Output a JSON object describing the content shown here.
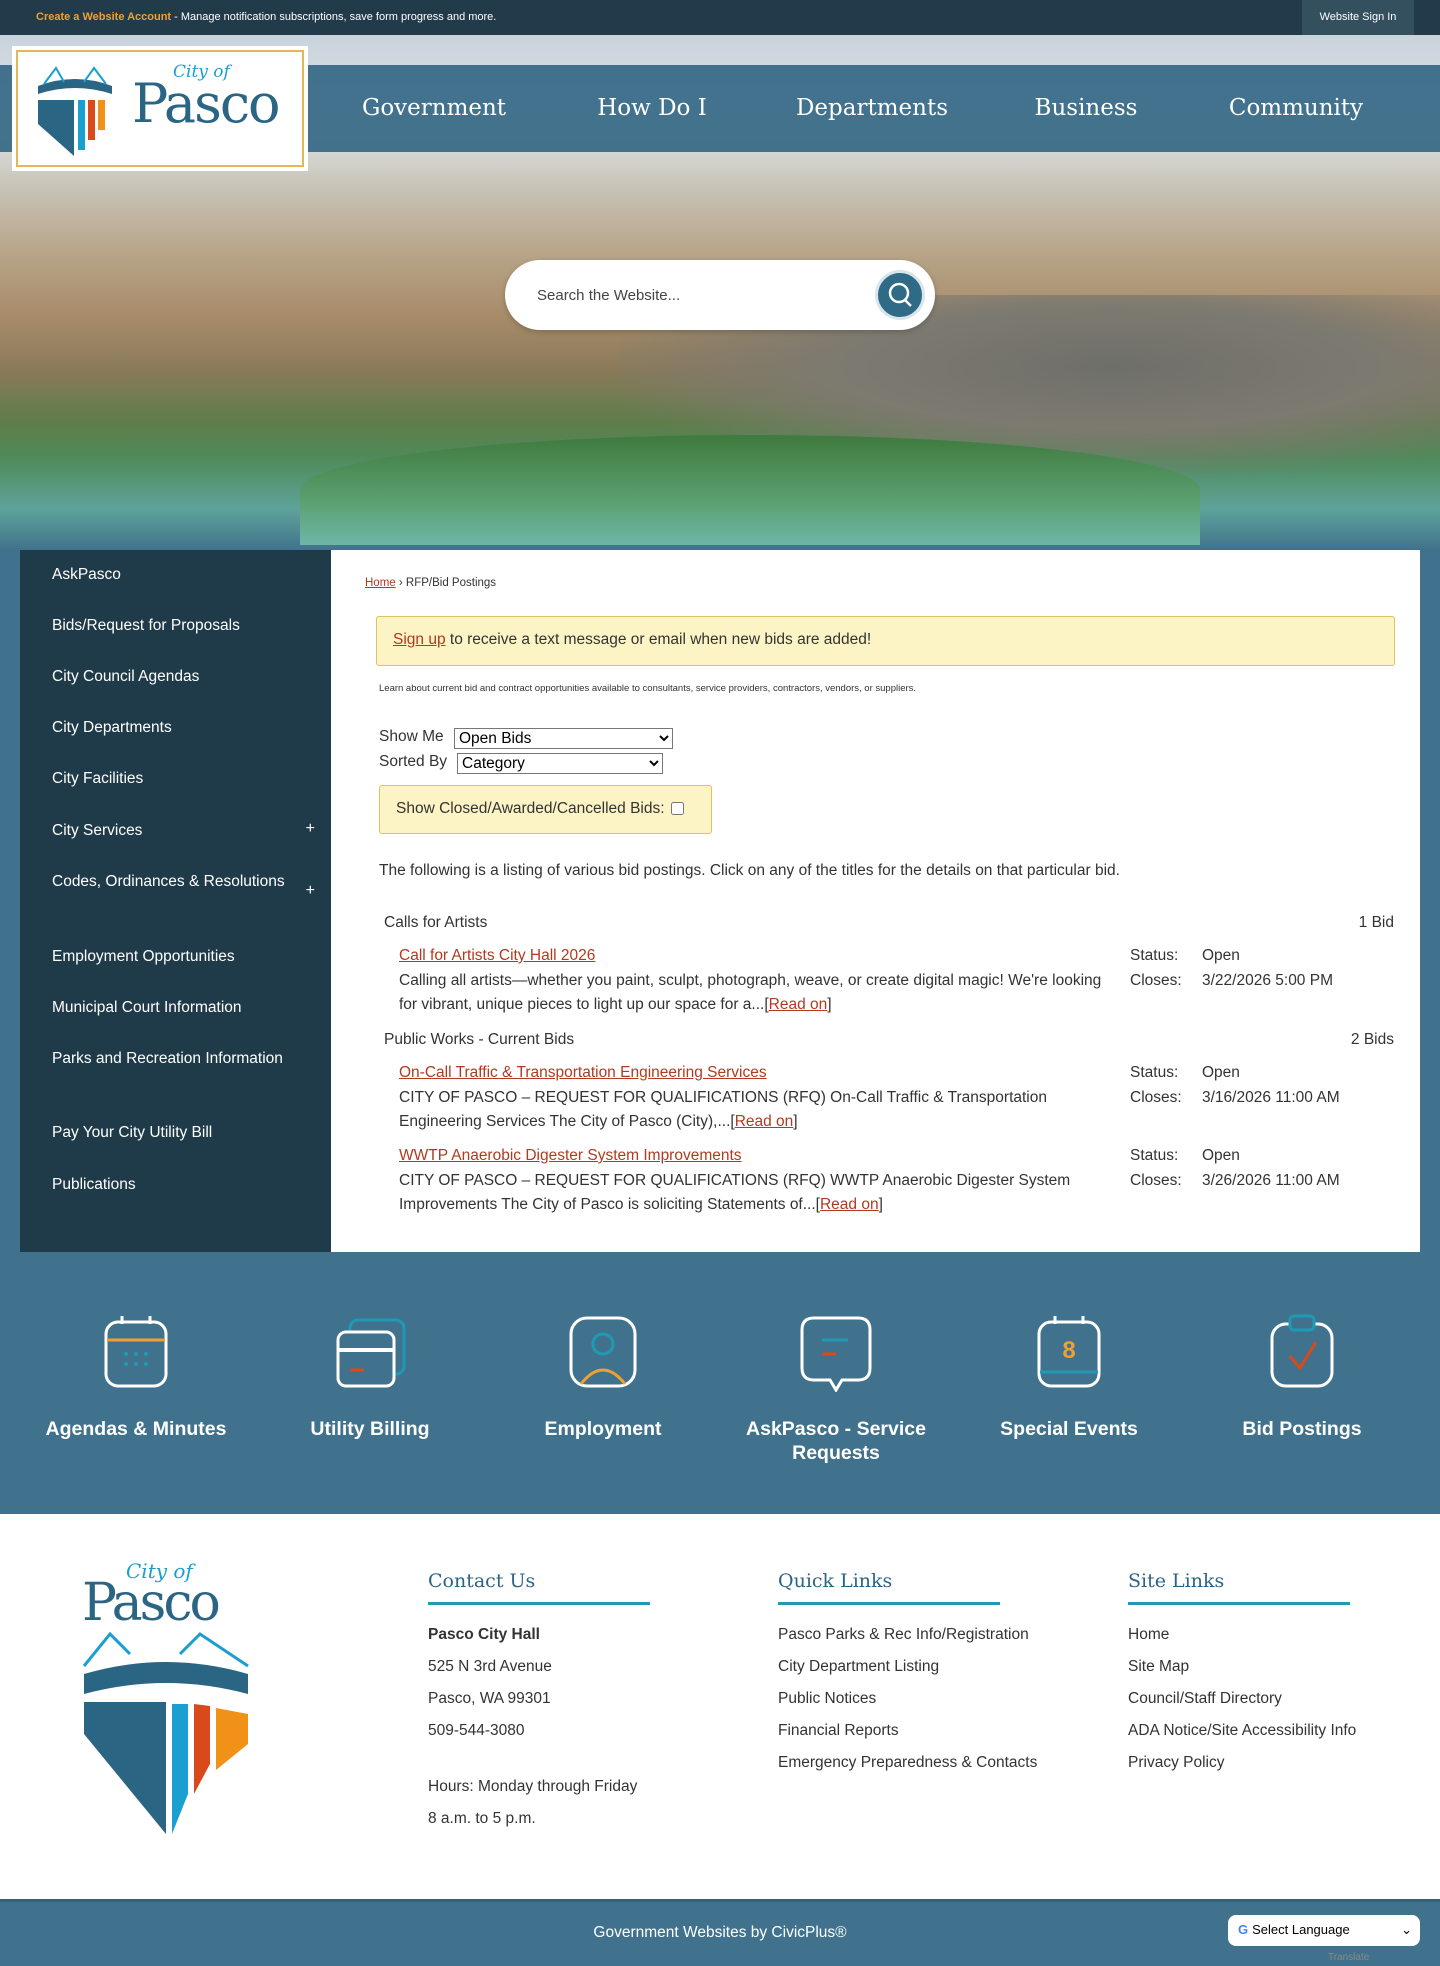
{
  "topbar": {
    "create_account": "Create a Website Account",
    "message": " - Manage notification subscriptions, save form progress and more.",
    "sign_in": "Website Sign In"
  },
  "logo": {
    "city_of": "City of",
    "name": "Pasco"
  },
  "nav": [
    "Government",
    "How Do I",
    "Departments",
    "Business",
    "Community"
  ],
  "search": {
    "placeholder": "Search the Website..."
  },
  "sidebar": [
    {
      "label": "AskPasco"
    },
    {
      "label": "Bids/Request for Proposals"
    },
    {
      "label": "City Council Agendas"
    },
    {
      "label": "City Departments"
    },
    {
      "label": "City Facilities"
    },
    {
      "label": "City Services",
      "expand": "+"
    },
    {
      "label": "Codes, Ordinances & Resolutions",
      "expand": "+"
    },
    {
      "label": "Employment Opportunities"
    },
    {
      "label": "Municipal Court Information"
    },
    {
      "label": "Parks and Recreation Information"
    },
    {
      "label": "Pay Your City Utility Bill"
    },
    {
      "label": "Publications"
    }
  ],
  "breadcrumb": {
    "home": "Home",
    "sep": " › ",
    "current": "RFP/Bid Postings"
  },
  "signup": {
    "link": "Sign up",
    "text": " to receive a text message or email when new bids are added!"
  },
  "learn": "Learn about current bid and contract opportunities available to consultants, service providers, contractors, vendors, or suppliers.",
  "filters": {
    "show_me_label": "Show Me",
    "show_me_value": "Open Bids",
    "sorted_by_label": "Sorted By",
    "sorted_by_value": "Category",
    "closed_label": "Show Closed/Awarded/Cancelled Bids:"
  },
  "intro": "The following is a listing of various bid postings. Click on any of the titles for the details on that particular bid.",
  "categories": [
    {
      "name": "Calls for Artists",
      "count": "1 Bid",
      "bids": [
        {
          "title": "Call for Artists City Hall 2026",
          "desc": "Calling all artists—whether you paint, sculpt, photograph, weave, or create digital magic! We're looking for vibrant, unique pieces to light up our space for a...",
          "status_label": "Status:",
          "status": "Open",
          "closes_label": "Closes:",
          "closes": "3/22/2026 5:00 PM"
        }
      ]
    },
    {
      "name": "Public Works - Current Bids",
      "count": "2 Bids",
      "bids": [
        {
          "title": "On-Call Traffic & Transportation Engineering Services",
          "desc": "CITY OF PASCO – REQUEST FOR QUALIFICATIONS (RFQ) On-Call Traffic & Transportation Engineering Services The City of Pasco (City),...",
          "status_label": "Status:",
          "status": "Open",
          "closes_label": "Closes:",
          "closes": "3/16/2026 11:00 AM"
        },
        {
          "title": "WWTP Anaerobic Digester System Improvements",
          "desc": "CITY OF PASCO – REQUEST FOR QUALIFICATIONS (RFQ) WWTP Anaerobic Digester System Improvements The City of Pasco is soliciting Statements of...",
          "status_label": "Status:",
          "status": "Open",
          "closes_label": "Closes:",
          "closes": "3/26/2026 11:00 AM"
        }
      ]
    }
  ],
  "read_on": "Read on",
  "tiles": [
    "Agendas & Minutes",
    "Utility Billing",
    "Employment",
    "AskPasco - Service Requests",
    "Special Events",
    "Bid Postings"
  ],
  "footer": {
    "contact": {
      "title": "Contact Us",
      "name": "Pasco City Hall",
      "address1": "525 N 3rd Avenue",
      "address2": "Pasco, WA 99301",
      "phone": "509-544-3080",
      "hours1": "Hours: Monday through Friday",
      "hours2": "8 a.m. to 5 p.m."
    },
    "quick": {
      "title": "Quick Links",
      "links": [
        "Pasco Parks & Rec Info/Registration",
        "City Department Listing",
        "Public Notices",
        "Financial Reports",
        "Emergency Preparedness & Contacts"
      ]
    },
    "site": {
      "title": "Site Links",
      "links": [
        "Home",
        "Site Map",
        "Council/Staff Directory",
        "ADA Notice/Site Accessibility Info",
        "Privacy Policy"
      ]
    }
  },
  "bottom": {
    "credit": "Government Websites by CivicPlus®",
    "language": "Select Language",
    "translate": "Translate"
  },
  "colors": {
    "dark": "#1f3a48",
    "blue": "#41728d",
    "accent": "#b13a1f",
    "orange": "#f0a030",
    "teal": "#1e9ab5"
  }
}
